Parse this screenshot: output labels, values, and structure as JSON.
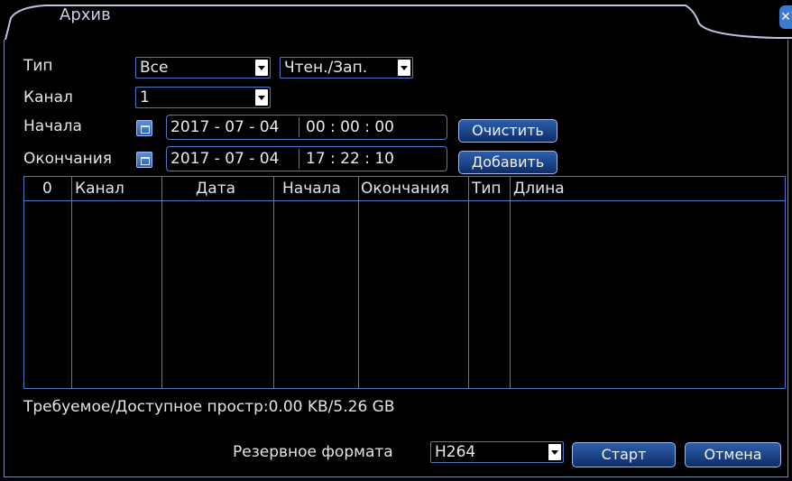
{
  "window": {
    "title": "Архив"
  },
  "filters": {
    "type_label": "Тип",
    "type_value": "Все",
    "rw_value": "Чтен./Зап.",
    "channel_label": "Канал",
    "channel_value": "1",
    "start_label": "Начала",
    "start_date": "2017 - 07 - 04",
    "start_time": "00 : 00 : 00",
    "end_label": "Окончания",
    "end_date": "2017 - 07 - 04",
    "end_time": "17 : 22 : 10"
  },
  "buttons": {
    "clear": "Очистить",
    "add": "Добавить",
    "start": "Старт",
    "cancel": "Отмена"
  },
  "table": {
    "columns": [
      "0",
      "Канал",
      "Дата",
      "Начала",
      "Окончания",
      "Тип",
      "Длина"
    ],
    "rows": []
  },
  "footer": {
    "space_text": "Требуемое/Доступное простр:0.00 KB/5.26 GB",
    "format_label": "Резервное формата",
    "format_value": "H264"
  },
  "colors": {
    "accent": "#4d78c8",
    "button": "#1f4a94",
    "background": "#000000"
  }
}
